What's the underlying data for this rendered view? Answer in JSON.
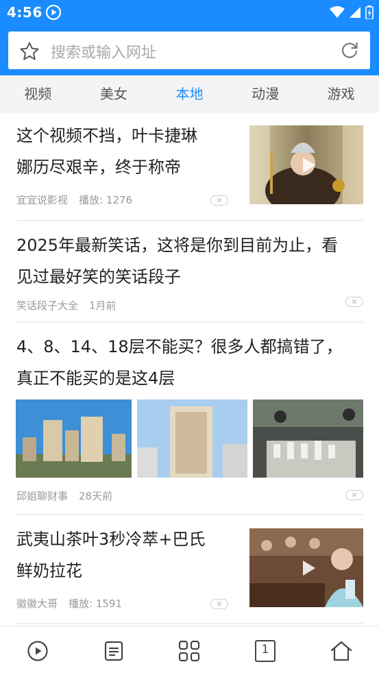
{
  "status": {
    "time": "4:56"
  },
  "search": {
    "placeholder": "搜索或输入网址"
  },
  "tabs": [
    {
      "label": "视频",
      "active": false
    },
    {
      "label": "美女",
      "active": false
    },
    {
      "label": "本地",
      "active": true
    },
    {
      "label": "动漫",
      "active": false
    },
    {
      "label": "游戏",
      "active": false
    }
  ],
  "feed": [
    {
      "title_lines": [
        "这个视频不挡，叶卡捷琳",
        "娜历尽艰辛，终于称帝"
      ],
      "source": "宜宜说影视",
      "stat": "播放: 1276",
      "type": "video"
    },
    {
      "title_lines": [
        "2025年最新笑话，这将是你到目前为止，看",
        "见过最好笑的笑话段子"
      ],
      "source": "笑话段子大全",
      "stat": "1月前",
      "type": "text"
    },
    {
      "title_lines": [
        "4、8、14、18层不能买？很多人都搞错了，",
        "真正不能买的是这4层"
      ],
      "source": "邱姐聊财事",
      "stat": "28天前",
      "type": "images"
    },
    {
      "title_lines": [
        "武夷山茶叶3秒冷萃+巴氏",
        "鲜奶拉花"
      ],
      "source": "徽徽大哥",
      "stat": "播放: 1591",
      "type": "video"
    }
  ],
  "close_glyph": "✕",
  "bottom_nav": [
    {
      "icon": "play-circle-icon"
    },
    {
      "icon": "news-list-icon"
    },
    {
      "icon": "grid-icon"
    },
    {
      "icon": "tabs-count-icon",
      "value": "1"
    },
    {
      "icon": "home-icon"
    }
  ],
  "colors": {
    "accent": "#1a8cff"
  }
}
